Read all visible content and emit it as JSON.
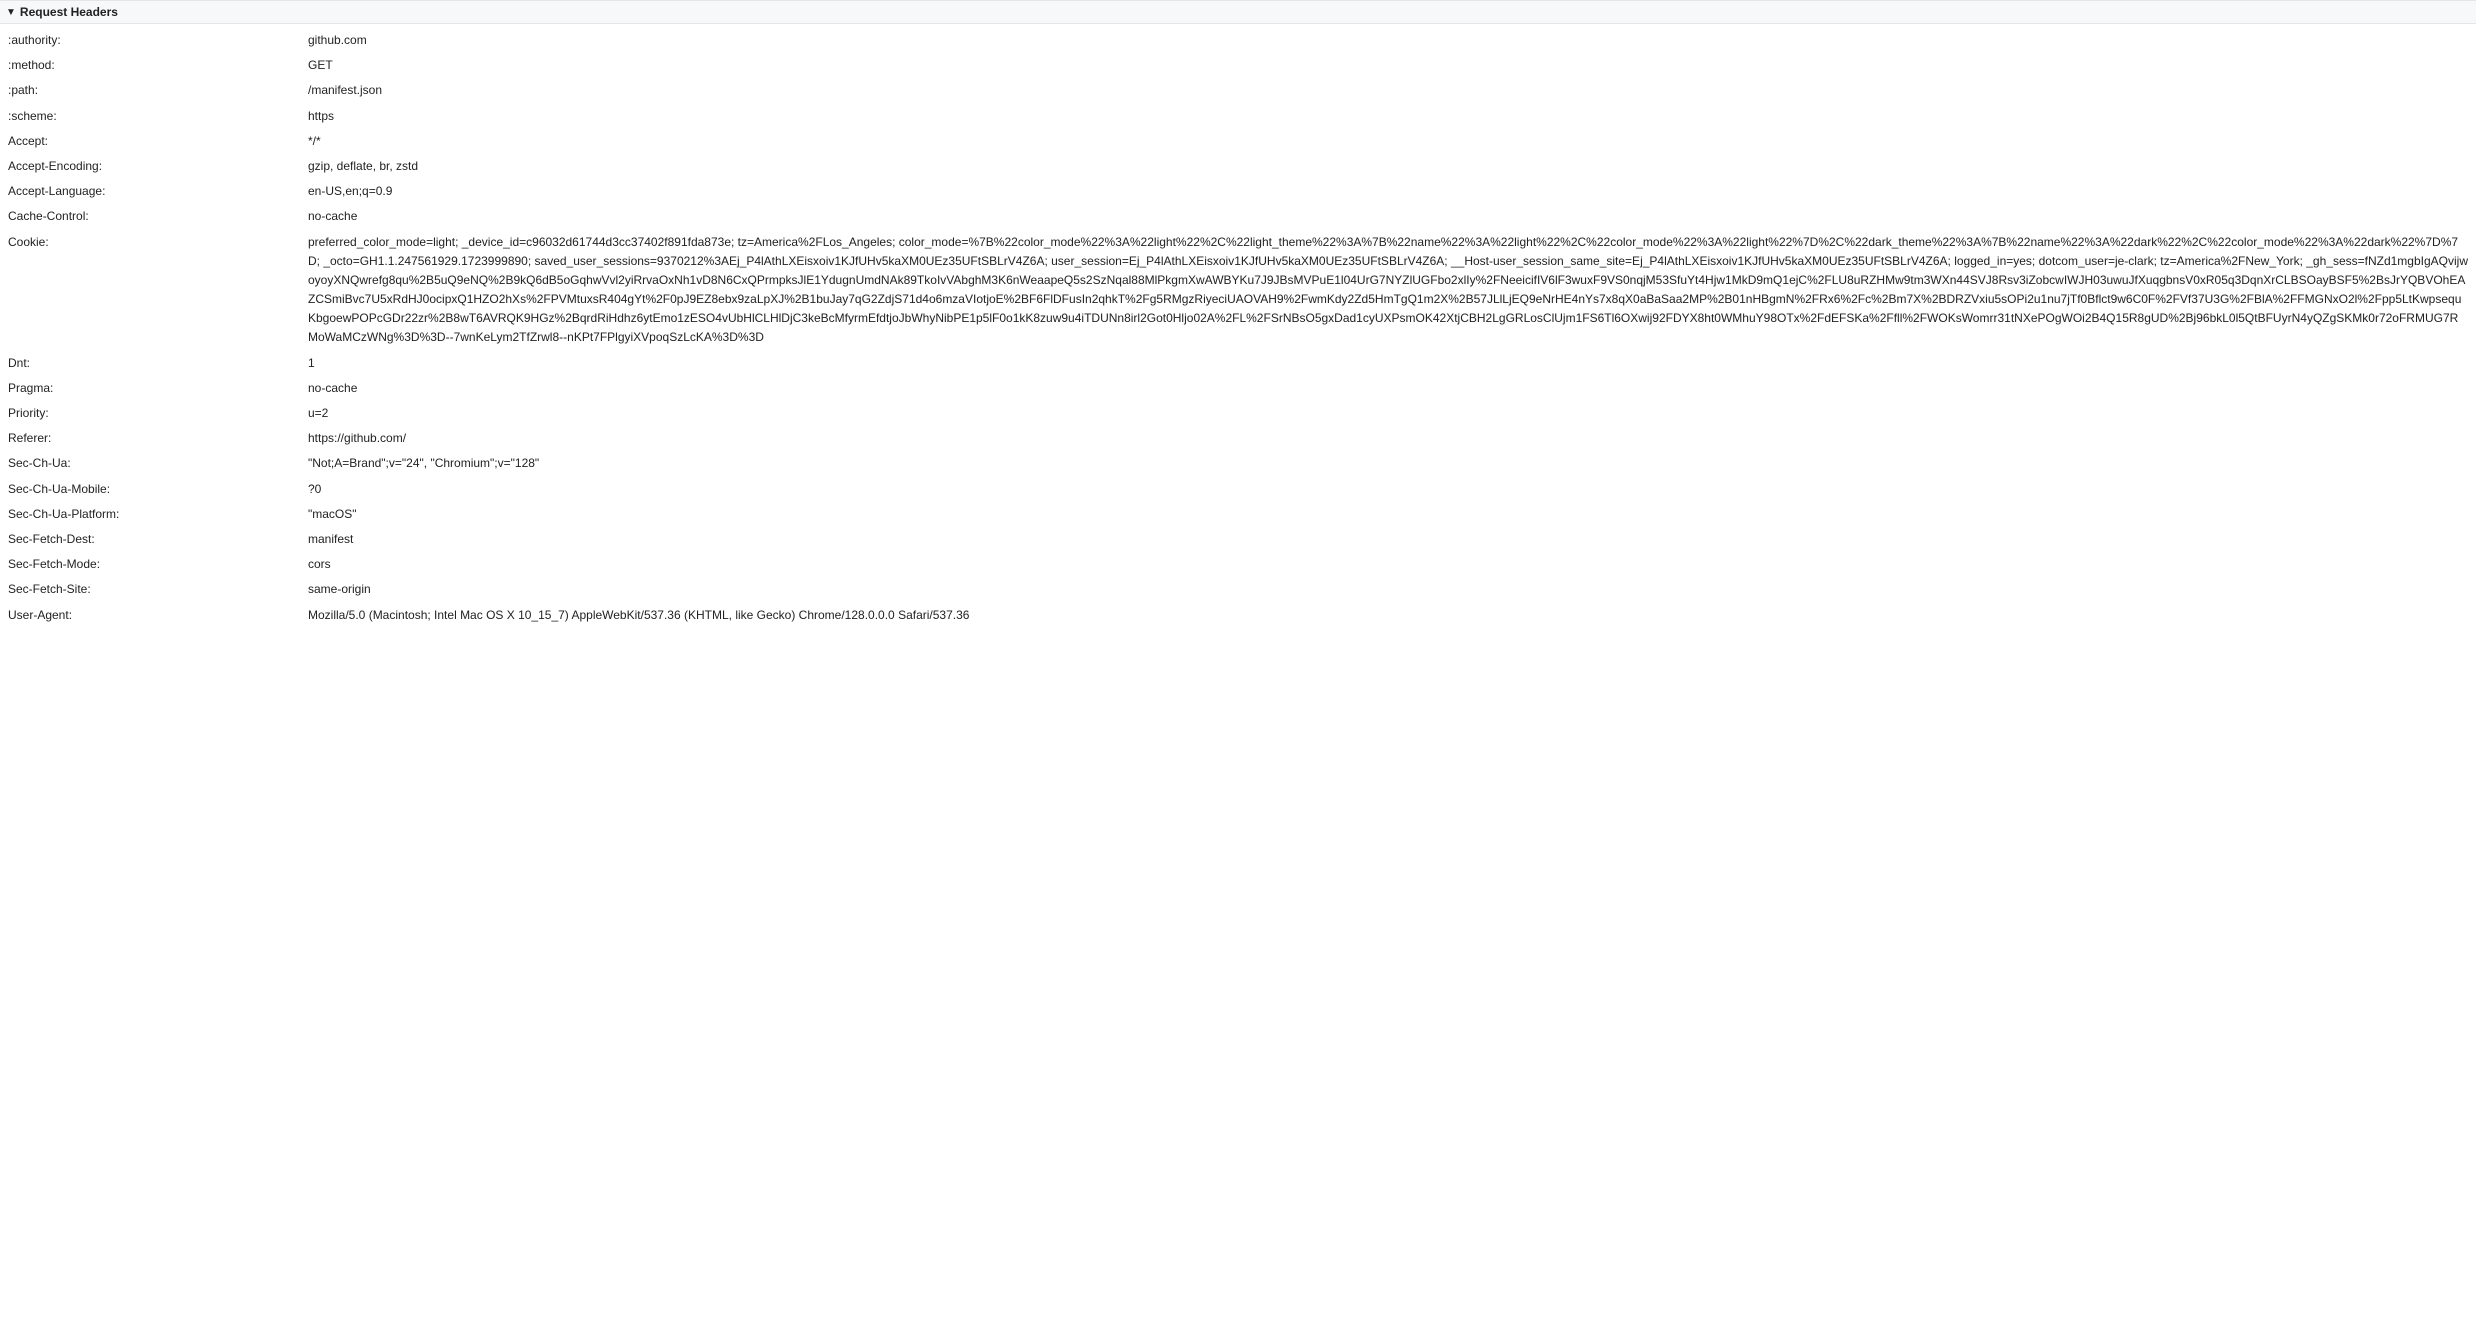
{
  "section": {
    "title": "Request Headers"
  },
  "headers": [
    {
      "name": ":authority:",
      "value": "github.com"
    },
    {
      "name": ":method:",
      "value": "GET"
    },
    {
      "name": ":path:",
      "value": "/manifest.json"
    },
    {
      "name": ":scheme:",
      "value": "https"
    },
    {
      "name": "Accept:",
      "value": "*/*"
    },
    {
      "name": "Accept-Encoding:",
      "value": "gzip, deflate, br, zstd"
    },
    {
      "name": "Accept-Language:",
      "value": "en-US,en;q=0.9"
    },
    {
      "name": "Cache-Control:",
      "value": "no-cache"
    },
    {
      "name": "Cookie:",
      "value": "preferred_color_mode=light; _device_id=c96032d61744d3cc37402f891fda873e; tz=America%2FLos_Angeles; color_mode=%7B%22color_mode%22%3A%22light%22%2C%22light_theme%22%3A%7B%22name%22%3A%22light%22%2C%22color_mode%22%3A%22light%22%7D%2C%22dark_theme%22%3A%7B%22name%22%3A%22dark%22%2C%22color_mode%22%3A%22dark%22%7D%7D; _octo=GH1.1.247561929.1723999890; saved_user_sessions=9370212%3AEj_P4lAthLXEisxoiv1KJfUHv5kaXM0UEz35UFtSBLrV4Z6A; user_session=Ej_P4lAthLXEisxoiv1KJfUHv5kaXM0UEz35UFtSBLrV4Z6A; __Host-user_session_same_site=Ej_P4lAthLXEisxoiv1KJfUHv5kaXM0UEz35UFtSBLrV4Z6A; logged_in=yes; dotcom_user=je-clark; tz=America%2FNew_York; _gh_sess=fNZd1mgbIgAQvijwoyoyXNQwrefg8qu%2B5uQ9eNQ%2B9kQ6dB5oGqhwVvl2yiRrvaOxNh1vD8N6CxQPrmpksJlE1YdugnUmdNAk89TkoIvVAbghM3K6nWeaapeQ5s2SzNqal88MlPkgmXwAWBYKu7J9JBsMVPuE1l04UrG7NYZlUGFbo2xlIy%2FNeeicifIV6lF3wuxF9VS0nqjM53SfuYt4Hjw1MkD9mQ1ejC%2FLU8uRZHMw9tm3WXn44SVJ8Rsv3iZobcwIWJH03uwuJfXuqgbnsV0xR05q3DqnXrCLBSOayBSF5%2BsJrYQBVOhEAZCSmiBvc7U5xRdHJ0ocipxQ1HZO2hXs%2FPVMtuxsR404gYt%2F0pJ9EZ8ebx9zaLpXJ%2B1buJay7qG2ZdjS71d4o6mzaVIotjoE%2BF6FlDFusIn2qhkT%2Fg5RMgzRiyeciUAOVAH9%2FwmKdy2Zd5HmTgQ1m2X%2B57JLlLjEQ9eNrHE4nYs7x8qX0aBaSaa2MP%2B01nHBgmN%2FRx6%2Fc%2Bm7X%2BDRZVxiu5sOPi2u1nu7jTf0Bflct9w6C0F%2FVf37U3G%2FBlA%2FFMGNxO2l%2Fpp5LtKwpsequKbgoewPOPcGDr22zr%2B8wT6AVRQK9HGz%2BqrdRiHdhz6ytEmo1zESO4vUbHlCLHlDjC3keBcMfyrmEfdtjoJbWhyNibPE1p5lF0o1kK8zuw9u4iTDUNn8irl2Got0Hljo02A%2FL%2FSrNBsO5gxDad1cyUXPsmOK42XtjCBH2LgGRLosClUjm1FS6Tl6OXwij92FDYX8ht0WMhuY98OTx%2FdEFSKa%2Ffll%2FWOKsWomrr31tNXePOgWOi2B4Q15R8gUD%2Bj96bkL0l5QtBFUyrN4yQZgSKMk0r72oFRMUG7RMoWaMCzWNg%3D%3D--7wnKeLym2TfZrwl8--nKPt7FPlgyiXVpoqSzLcKA%3D%3D"
    },
    {
      "name": "Dnt:",
      "value": "1"
    },
    {
      "name": "Pragma:",
      "value": "no-cache"
    },
    {
      "name": "Priority:",
      "value": "u=2"
    },
    {
      "name": "Referer:",
      "value": "https://github.com/"
    },
    {
      "name": "Sec-Ch-Ua:",
      "value": "\"Not;A=Brand\";v=\"24\", \"Chromium\";v=\"128\""
    },
    {
      "name": "Sec-Ch-Ua-Mobile:",
      "value": "?0"
    },
    {
      "name": "Sec-Ch-Ua-Platform:",
      "value": "\"macOS\""
    },
    {
      "name": "Sec-Fetch-Dest:",
      "value": "manifest"
    },
    {
      "name": "Sec-Fetch-Mode:",
      "value": "cors"
    },
    {
      "name": "Sec-Fetch-Site:",
      "value": "same-origin"
    },
    {
      "name": "User-Agent:",
      "value": "Mozilla/5.0 (Macintosh; Intel Mac OS X 10_15_7) AppleWebKit/537.36 (KHTML, like Gecko) Chrome/128.0.0.0 Safari/537.36"
    }
  ]
}
